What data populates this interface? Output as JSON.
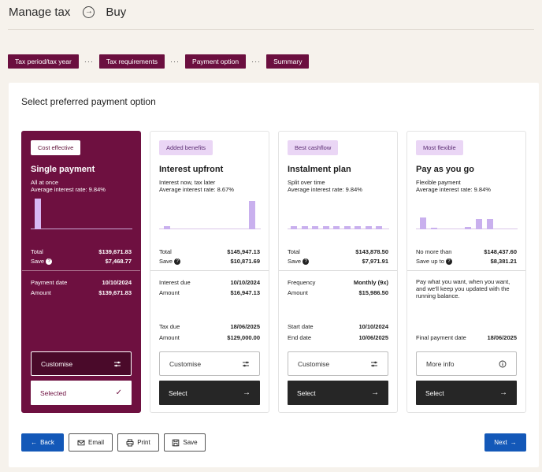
{
  "header": {
    "title": "Manage tax",
    "current": "Buy"
  },
  "steps": [
    "Tax period/tax year",
    "Tax requirements",
    "Payment option",
    "Summary"
  ],
  "step_separator": "···",
  "panel": {
    "title": "Select preferred payment option"
  },
  "cards": [
    {
      "badge": "Cost effective",
      "title": "Single payment",
      "subtitle": "All at once",
      "rate": "Average interest rate: 9.84%",
      "bars": [
        0.92
      ],
      "total_label": "Total",
      "total_value": "$139,671.83",
      "save_label": "Save",
      "save_value": "$7,468.77",
      "rows1": [
        {
          "label": "Payment date",
          "value": "10/10/2024"
        },
        {
          "label": "Amount",
          "value": "$139,671.83"
        }
      ],
      "customise_label": "Customise",
      "action_label": "Selected",
      "selected": true
    },
    {
      "badge": "Added benefits",
      "title": "Interest upfront",
      "subtitle": "Interest now, tax later",
      "rate": "Average interest rate: 8.67%",
      "bars": [
        0.1,
        0.85
      ],
      "total_label": "Total",
      "total_value": "$145,947.13",
      "save_label": "Save",
      "save_value": "$10,871.69",
      "rows1": [
        {
          "label": "Interest due",
          "value": "10/10/2024"
        },
        {
          "label": "Amount",
          "value": "$16,947.13"
        }
      ],
      "rows2": [
        {
          "label": "Tax due",
          "value": "18/06/2025"
        },
        {
          "label": "Amount",
          "value": "$129,000.00"
        }
      ],
      "customise_label": "Customise",
      "action_label": "Select"
    },
    {
      "badge": "Best cashflow",
      "title": "Instalment plan",
      "subtitle": "Split over time",
      "rate": "Average interest rate: 9.84%",
      "bars": [
        0.1,
        0.1,
        0.1,
        0.1,
        0.1,
        0.1,
        0.1,
        0.1,
        0.1
      ],
      "total_label": "Total",
      "total_value": "$143,878.50",
      "save_label": "Save",
      "save_value": "$7,971.91",
      "rows1": [
        {
          "label": "Frequency",
          "value": "Monthly (9x)"
        },
        {
          "label": "Amount",
          "value": "$15,986.50"
        }
      ],
      "rows2": [
        {
          "label": "Start date",
          "value": "10/10/2024"
        },
        {
          "label": "End date",
          "value": "10/06/2025"
        }
      ],
      "customise_label": "Customise",
      "action_label": "Select"
    },
    {
      "badge": "Most flexible",
      "title": "Pay as you go",
      "subtitle": "Flexible payment",
      "rate": "Average interest rate: 9.84%",
      "bars": [
        0.35,
        0.05,
        0,
        0,
        0.08,
        0.32,
        0.3
      ],
      "total_label": "No more than",
      "total_value": "$148,437.60",
      "save_label": "Save up to",
      "save_value": "$8,381.21",
      "description": "Pay what you want, when you want, and we'll keep you updated with the running balance.",
      "rows2": [
        {
          "label": "Final payment date",
          "value": "18/06/2025"
        }
      ],
      "customise_label": "More info",
      "action_label": "Select"
    }
  ],
  "footer": {
    "back": "Back",
    "email": "Email",
    "print": "Print",
    "save": "Save",
    "next": "Next"
  }
}
